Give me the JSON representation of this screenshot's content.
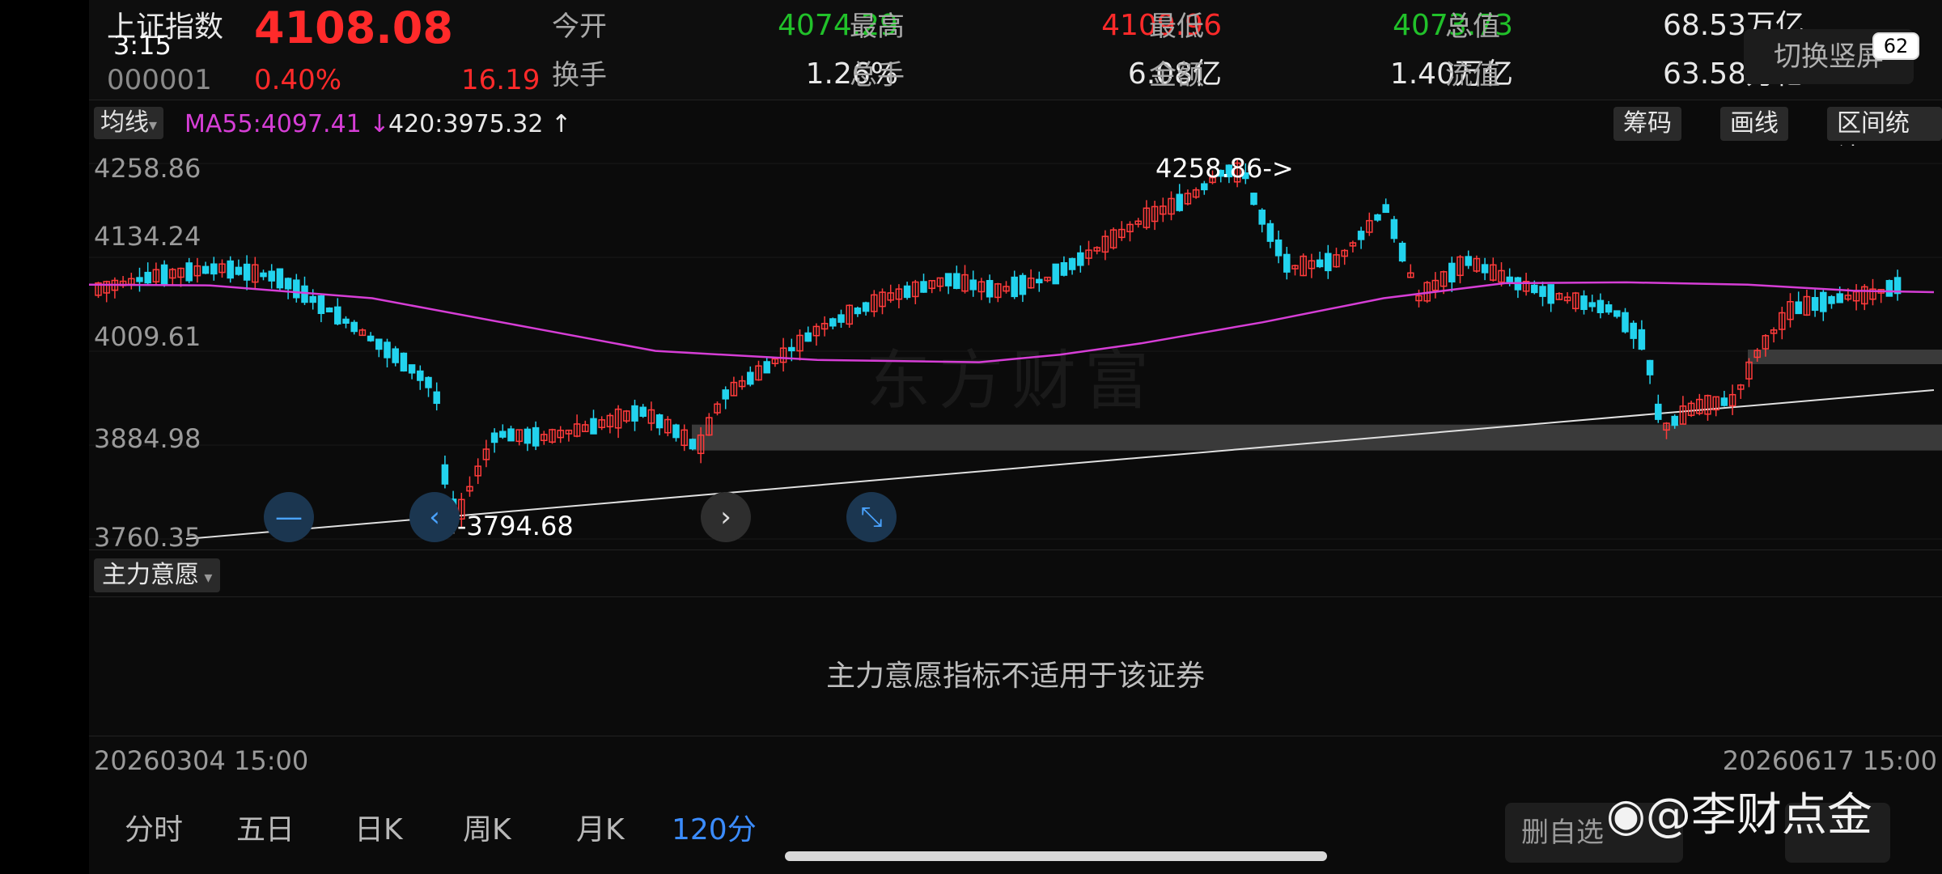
{
  "status": {
    "time": "3:15",
    "battery": "62"
  },
  "quote": {
    "name": "上证指数",
    "price": "4108.08",
    "code": "000001",
    "pct": "0.40%",
    "change": "16.19",
    "fields": [
      {
        "label": "今开",
        "value": "4074.29",
        "color": "green"
      },
      {
        "label": "最高",
        "value": "4109.96",
        "color": "red"
      },
      {
        "label": "最低",
        "value": "4073.73",
        "color": "green"
      },
      {
        "label": "总值",
        "value": "68.53万亿",
        "color": "white"
      },
      {
        "label": "换手",
        "value": "1.26%",
        "color": "white"
      },
      {
        "label": "总手",
        "value": "6.08亿",
        "color": "white"
      },
      {
        "label": "金额",
        "value": "1.40万亿",
        "color": "white"
      },
      {
        "label": "流值",
        "value": "63.58万亿",
        "color": "white"
      }
    ],
    "landscape_button": "切换竖屏"
  },
  "ma_bar": {
    "toggle_label": "均线",
    "ma55": "MA55:4097.41",
    "ma55_arrow": "↓",
    "ma420": "420:3975.32",
    "ma420_arrow": "↑"
  },
  "tools": {
    "chips": "筹码",
    "draw": "画线",
    "range_stats": "区间统计"
  },
  "chart": {
    "y_axis": [
      "4258.86",
      "4134.24",
      "4009.61",
      "3884.98",
      "3760.35"
    ],
    "ymin": 3760.35,
    "ymax": 4258.86,
    "high_annotation": "4258.86->",
    "low_annotation": "<-3794.68",
    "watermark": "东方财富",
    "ma55_color": "#d63ed6",
    "up_color": "#ff3b3b",
    "down_color": "#22d3ee",
    "trend_line": [
      3760.35,
      3958
    ],
    "gray_band_price": 3895
  },
  "indicator": {
    "toggle_label": "主力意愿",
    "message": "主力意愿指标不适用于该证券"
  },
  "dates": {
    "start": "20260304 15:00",
    "end": "20260617 15:00"
  },
  "periods": {
    "items": [
      "分时",
      "五日",
      "日K",
      "周K",
      "月K",
      "120分"
    ],
    "active_index": 5
  },
  "bottom": {
    "delete_label": "删自选",
    "watermark_user": "@李财点金"
  },
  "colors": {
    "accent": "#3b8cff",
    "up": "#ff2a2a",
    "down": "#21c12a"
  }
}
